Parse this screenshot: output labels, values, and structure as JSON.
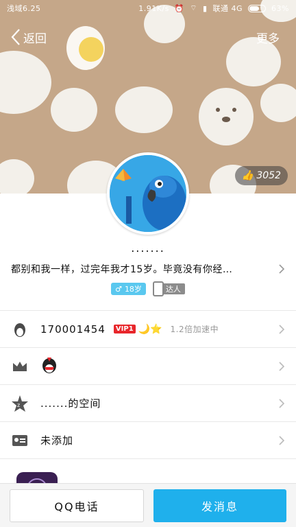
{
  "status_bar": {
    "carrier": "浅域6.25",
    "speed": "1.91K/s",
    "network": "联通 4G",
    "battery": "63%"
  },
  "nav": {
    "back_label": "返回",
    "more_label": "更多"
  },
  "likes": "3052",
  "profile": {
    "nickname": ".......",
    "signature": "都别和我一样，过完年我才15岁。毕竟没有你经…",
    "age_tag": "18岁",
    "talent_tag": "达人"
  },
  "rows": {
    "qq_number": "170001454",
    "vip_badge": "VIP1",
    "vip_icons": "🌙⭐",
    "speed_text": "1.2倍加速中",
    "space_text": ".......的空间",
    "card_text": "未添加"
  },
  "buttons": {
    "call": "QQ电话",
    "message": "发消息"
  },
  "colors": {
    "cover_bg": "#c5a789",
    "accent": "#1fb0ec",
    "vip": "#e8262b"
  }
}
